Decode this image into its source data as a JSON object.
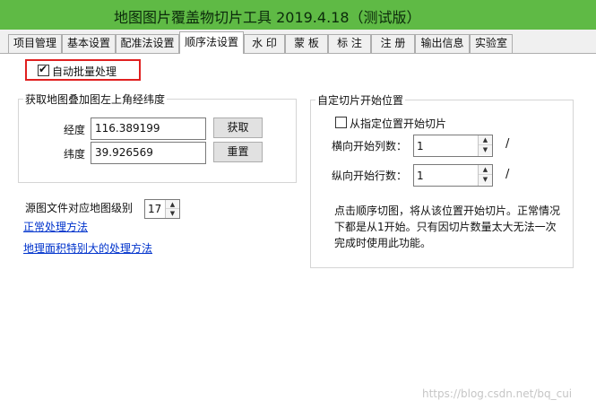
{
  "window": {
    "title": "地图图片覆盖物切片工具 2019.4.18（测试版）"
  },
  "tabs": [
    {
      "label": "项目管理"
    },
    {
      "label": "基本设置"
    },
    {
      "label": "配准法设置"
    },
    {
      "label": "顺序法设置",
      "active": true
    },
    {
      "label": "水 印"
    },
    {
      "label": "蒙 板"
    },
    {
      "label": "标 注"
    },
    {
      "label": "注 册"
    },
    {
      "label": "输出信息"
    },
    {
      "label": "实验室"
    }
  ],
  "auto_batch": {
    "label": "自动批量处理",
    "checked": true
  },
  "coord_group": {
    "title": "获取地图叠加图左上角经纬度",
    "longitude_label": "经度",
    "longitude_value": "116.389199",
    "latitude_label": "纬度",
    "latitude_value": "39.926569",
    "get_button": "获取",
    "reset_button": "重置"
  },
  "zoom": {
    "label": "源图文件对应地图级别",
    "value": "17"
  },
  "links": {
    "normal_method": "正常处理方法",
    "large_area_method": "地理面积特别大的处理方法"
  },
  "start_group": {
    "title": "自定切片开始位置",
    "from_position": {
      "label": "从指定位置开始切片",
      "checked": false
    },
    "col_label": "横向开始列数：",
    "col_value": "1",
    "col_suffix": "/",
    "row_label": "纵向开始行数：",
    "row_value": "1",
    "row_suffix": "/",
    "note_line1": "点击顺序切图，将从该位置开始切片。正常情况",
    "note_line2": "下都是从1开始。只有因切片数量太大无法一次",
    "note_line3": "完成时使用此功能。"
  },
  "watermark": "https://blog.csdn.net/bq_cui"
}
